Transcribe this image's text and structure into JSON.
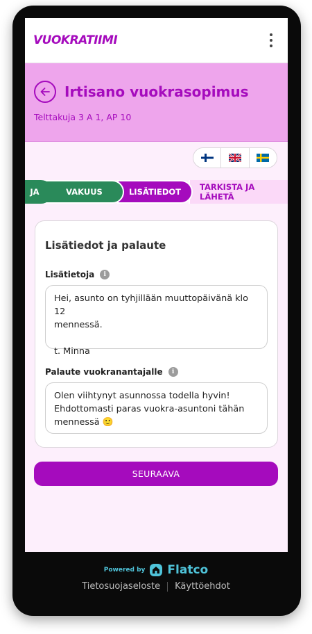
{
  "app": {
    "logo": "VUOKRATIIMI"
  },
  "header": {
    "title": "Irtisano vuokrasopimus",
    "address": "Telttakuja 3 A 1, AP 10"
  },
  "languages": [
    {
      "code": "fi",
      "icon": "finland-flag-icon"
    },
    {
      "code": "en",
      "icon": "uk-flag-icon"
    },
    {
      "code": "sv",
      "icon": "sweden-flag-icon"
    }
  ],
  "steps": [
    {
      "label": "JA",
      "state": "done"
    },
    {
      "label": "VAKUUS",
      "state": "done"
    },
    {
      "label": "LISÄTIEDOT",
      "state": "active"
    },
    {
      "label": "TARKISTA JA LÄHETÄ",
      "state": "todo"
    }
  ],
  "form": {
    "title": "Lisätiedot ja palaute",
    "info_label": "Lisätietoja",
    "info_value": "Hei, asunto on tyhjillään muuttopäivänä klo 12\nmennessä.\n\nt. Minna",
    "feedback_label": "Palaute vuokranantajalle",
    "feedback_value": "Olen viihtynyt asunnossa todella hyvin!\nEhdottomasti paras vuokra-asuntoni tähän\nmennessä 🙂"
  },
  "next_button": "SEURAAVA",
  "footer": {
    "powered_by": "Powered by",
    "brand": "Flatco",
    "privacy": "Tietosuojaseloste",
    "terms": "Käyttöehdot"
  },
  "colors": {
    "accent": "#a50bbd",
    "done": "#2a8a5a",
    "header_bg": "#eea5ec",
    "footer_brand": "#4fc3d9"
  }
}
